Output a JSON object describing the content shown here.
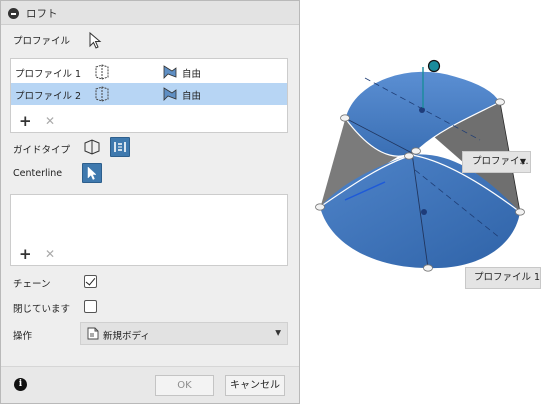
{
  "dialog": {
    "title": "ロフト",
    "profiles_label": "プロファイル",
    "profiles": [
      {
        "name": "プロファイル 1",
        "condition": "自由",
        "selected": false
      },
      {
        "name": "プロファイル 2",
        "condition": "自由",
        "selected": true
      }
    ],
    "guide_type_label": "ガイドタイプ",
    "centerline_label": "Centerline",
    "chain_label": "チェーン",
    "chain_checked": true,
    "closed_label": "閉じています",
    "closed_checked": false,
    "operation_label": "操作",
    "operation_value": "新規ボディ",
    "ok_label": "OK",
    "cancel_label": "キャンセル"
  },
  "viewport": {
    "profile2_label": "プロファイ...",
    "profile1_label": "プロファイル 1"
  },
  "colors": {
    "accent": "#3f79ae",
    "selection": "#b7d5f4",
    "body_blue": "#3f79c4",
    "manipulator": "#1a8c9c"
  }
}
